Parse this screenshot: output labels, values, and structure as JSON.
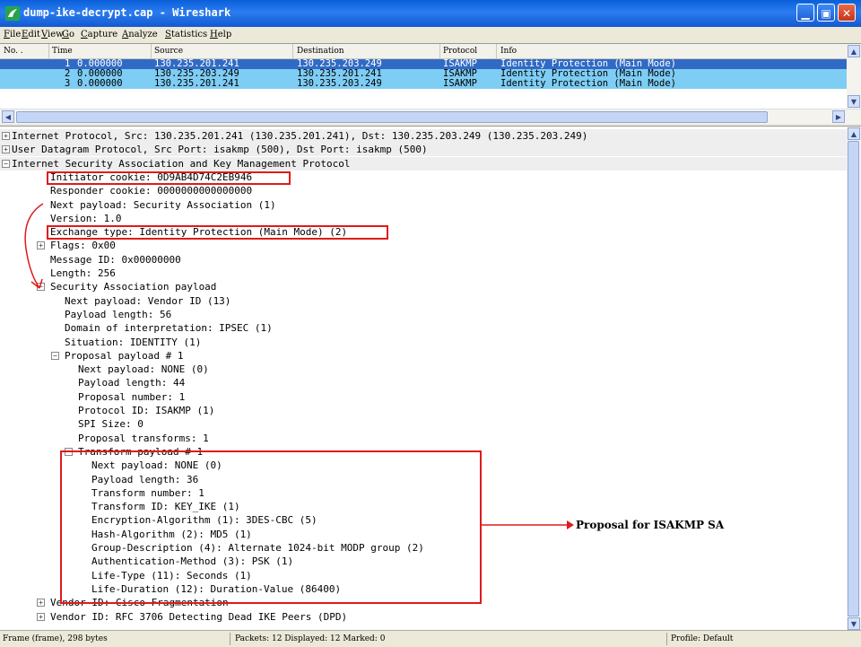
{
  "window": {
    "title": "dump-ike-decrypt.cap - Wireshark"
  },
  "menu": [
    {
      "key": "F",
      "rest": "ile"
    },
    {
      "key": "E",
      "rest": "dit"
    },
    {
      "key": "V",
      "rest": "iew"
    },
    {
      "key": "G",
      "rest": "o"
    },
    {
      "key": "C",
      "rest": "apture"
    },
    {
      "key": "A",
      "rest": "nalyze"
    },
    {
      "key": "S",
      "rest": "tatistics"
    },
    {
      "key": "H",
      "rest": "elp"
    }
  ],
  "packet_list": {
    "columns": [
      "No. .",
      "Time",
      "Source",
      "Destination",
      "Protocol",
      "Info"
    ],
    "rows": [
      {
        "no": "1",
        "time": "0.000000",
        "src": "130.235.201.241",
        "dst": "130.235.203.249",
        "proto": "ISAKMP",
        "info": "Identity Protection (Main Mode)",
        "style": "selected"
      },
      {
        "no": "2",
        "time": "0.000000",
        "src": "130.235.203.249",
        "dst": "130.235.201.241",
        "proto": "ISAKMP",
        "info": "Identity Protection (Main Mode)",
        "style": "isakmp"
      },
      {
        "no": "3",
        "time": "0.000000",
        "src": "130.235.201.241",
        "dst": "130.235.203.249",
        "proto": "ISAKMP",
        "info": "Identity Protection (Main Mode)",
        "style": "isakmp"
      }
    ]
  },
  "tree": [
    {
      "text": "Internet Protocol, Src: 130.235.201.241 (130.235.201.241), Dst: 130.235.203.249 (130.235.203.249)",
      "exp": "+"
    },
    {
      "text": "User Datagram Protocol, Src Port: isakmp (500), Dst Port: isakmp (500)",
      "exp": "+"
    },
    {
      "text": "Internet Security Association and Key Management Protocol",
      "exp": "-"
    },
    {
      "text": "Initiator cookie: 0D9AB4D74C2EB946"
    },
    {
      "text": "Responder cookie: 0000000000000000"
    },
    {
      "text": "Next payload: Security Association (1)"
    },
    {
      "text": "Version: 1.0"
    },
    {
      "text": "Exchange type: Identity Protection (Main Mode) (2)"
    },
    {
      "text": "Flags: 0x00",
      "exp": "+"
    },
    {
      "text": "Message ID: 0x00000000"
    },
    {
      "text": "Length: 256"
    },
    {
      "text": "Security Association payload",
      "exp": "-"
    },
    {
      "text": "Next payload: Vendor ID (13)"
    },
    {
      "text": "Payload length: 56"
    },
    {
      "text": "Domain of interpretation: IPSEC (1)"
    },
    {
      "text": "Situation: IDENTITY (1)"
    },
    {
      "text": "Proposal payload # 1",
      "exp": "-"
    },
    {
      "text": "Next payload: NONE (0)"
    },
    {
      "text": "Payload length: 44"
    },
    {
      "text": "Proposal number: 1"
    },
    {
      "text": "Protocol ID: ISAKMP (1)"
    },
    {
      "text": "SPI Size: 0"
    },
    {
      "text": "Proposal transforms: 1"
    },
    {
      "text": "Transform payload # 1",
      "exp": "-"
    },
    {
      "text": "Next payload: NONE (0)"
    },
    {
      "text": "Payload length: 36"
    },
    {
      "text": "Transform number: 1"
    },
    {
      "text": "Transform ID: KEY_IKE (1)"
    },
    {
      "text": "Encryption-Algorithm (1): 3DES-CBC (5)"
    },
    {
      "text": "Hash-Algorithm (2): MD5 (1)"
    },
    {
      "text": "Group-Description (4): Alternate 1024-bit MODP group (2)"
    },
    {
      "text": "Authentication-Method (3): PSK (1)"
    },
    {
      "text": "Life-Type (11): Seconds (1)"
    },
    {
      "text": "Life-Duration (12): Duration-Value (86400)"
    },
    {
      "text": "Vendor ID: Cisco Fragmentation",
      "exp": "+"
    },
    {
      "text": "Vendor ID: RFC 3706 Detecting Dead IKE Peers (DPD)",
      "exp": "+"
    }
  ],
  "annotation": {
    "label": "Proposal for ISAKMP SA",
    "color": "#e01a1a"
  },
  "status": {
    "frame": "Frame (frame), 298 bytes",
    "packets": "Packets: 12 Displayed: 12 Marked: 0",
    "profile": "Profile: Default"
  }
}
